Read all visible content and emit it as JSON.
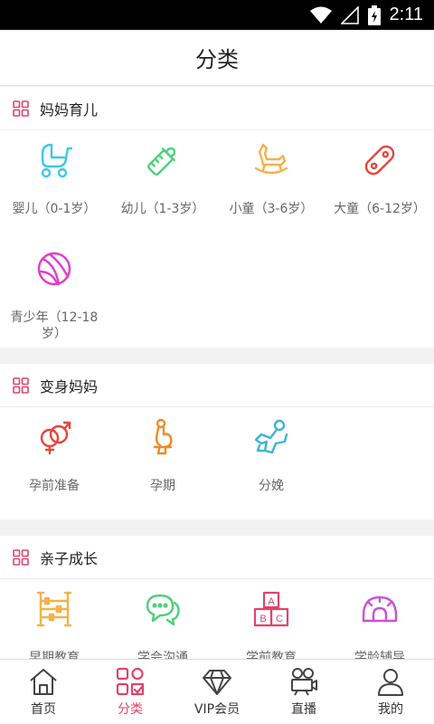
{
  "status": {
    "time": "2:11"
  },
  "header": {
    "title": "分类"
  },
  "sections": [
    {
      "title": "妈妈育儿",
      "items": [
        {
          "label": "婴儿（0-1岁）",
          "icon": "stroller-icon",
          "color": "#3cc8e6"
        },
        {
          "label": "幼儿（1-3岁）",
          "icon": "baby-bottle-icon",
          "color": "#4fcf7a"
        },
        {
          "label": "小童（3-6岁）",
          "icon": "rocking-horse-icon",
          "color": "#f5b14a"
        },
        {
          "label": "大童（6-12岁）",
          "icon": "skateboard-icon",
          "color": "#e8453c"
        },
        {
          "label": "青少年（12-18岁）",
          "label_line1": "青少年（12-18",
          "label_line2": "岁）",
          "icon": "ball-icon",
          "color": "#e23ccf"
        }
      ]
    },
    {
      "title": "变身妈妈",
      "items": [
        {
          "label": "孕前准备",
          "icon": "gender-icon",
          "color": "#e8453c"
        },
        {
          "label": "孕期",
          "icon": "pregnant-icon",
          "color": "#f08a24"
        },
        {
          "label": "分娩",
          "icon": "delivery-icon",
          "color": "#3cb5d6"
        }
      ]
    },
    {
      "title": "亲子成长",
      "items": [
        {
          "label": "早期教育",
          "icon": "abacus-icon",
          "color": "#f5b14a"
        },
        {
          "label": "学会沟通",
          "icon": "chat-icon",
          "color": "#4fcf7a"
        },
        {
          "label": "学前教育",
          "icon": "abc-blocks-icon",
          "color": "#e0436b"
        },
        {
          "label": "学龄辅导",
          "icon": "protractor-icon",
          "color": "#c653d8"
        }
      ]
    }
  ],
  "tabs": [
    {
      "label": "首页",
      "icon": "home-icon",
      "active": false
    },
    {
      "label": "分类",
      "icon": "category-icon",
      "active": true
    },
    {
      "label": "VIP会员",
      "icon": "diamond-icon",
      "active": false
    },
    {
      "label": "直播",
      "icon": "video-camera-icon",
      "active": false
    },
    {
      "label": "我的",
      "icon": "user-icon",
      "active": false
    }
  ],
  "colors": {
    "accent": "#e0436b",
    "tab_inactive": "#333333"
  }
}
